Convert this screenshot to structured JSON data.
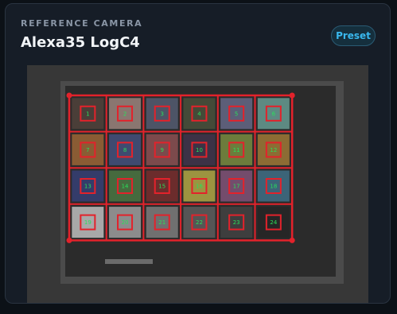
{
  "header": {
    "eyebrow": "REFERENCE CAMERA",
    "title": "Alexa35 LogC4",
    "preset_label": "Preset"
  },
  "accent_color": "#39b8ee",
  "grid_line_color": "#e3222b",
  "label_color": "#29e05a",
  "patches": [
    {
      "label": "1",
      "color": "#4a3e38"
    },
    {
      "label": "2",
      "color": "#8a7670"
    },
    {
      "label": "3",
      "color": "#4d5466"
    },
    {
      "label": "4",
      "color": "#444a38"
    },
    {
      "label": "5",
      "color": "#5c5e78"
    },
    {
      "label": "6",
      "color": "#5d8a82"
    },
    {
      "label": "7",
      "color": "#8a5c34"
    },
    {
      "label": "8",
      "color": "#3f4a70"
    },
    {
      "label": "9",
      "color": "#7c4a4c"
    },
    {
      "label": "10",
      "color": "#3c3246"
    },
    {
      "label": "11",
      "color": "#6c7c3c"
    },
    {
      "label": "12",
      "color": "#8c6c34"
    },
    {
      "label": "13",
      "color": "#343c6a"
    },
    {
      "label": "14",
      "color": "#466a3e"
    },
    {
      "label": "15",
      "color": "#6c2c2c"
    },
    {
      "label": "16",
      "color": "#9c9440"
    },
    {
      "label": "17",
      "color": "#744c6c"
    },
    {
      "label": "18",
      "color": "#3c6478"
    },
    {
      "label": "19",
      "color": "#a8a8a8"
    },
    {
      "label": "20",
      "color": "#8c8c8c"
    },
    {
      "label": "21",
      "color": "#707070"
    },
    {
      "label": "22",
      "color": "#555555"
    },
    {
      "label": "23",
      "color": "#3e3e3e"
    },
    {
      "label": "24",
      "color": "#262626"
    }
  ]
}
